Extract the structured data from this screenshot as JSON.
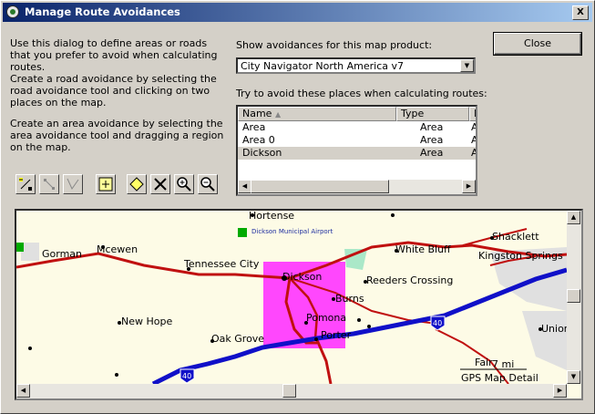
{
  "window": {
    "title": "Manage Route Avoidances",
    "close_glyph": "X"
  },
  "help": {
    "p1": "Use this dialog to define areas or roads that you prefer to avoid when calculating routes.",
    "p2": "Create a road avoidance by selecting the road avoidance tool and clicking on two places on the map.",
    "p3": "Create an area avoidance by selecting the area avoidance tool and dragging a region on the map."
  },
  "close_button": "Close",
  "product": {
    "label": "Show avoidances for this map product:",
    "value": "City Navigator North America v7"
  },
  "avoid_label": "Try to avoid these places when calculating routes:",
  "list": {
    "columns": [
      "Name",
      "Type",
      "P"
    ],
    "rows": [
      {
        "name": "Area",
        "type": "Area",
        "p": "A"
      },
      {
        "name": "Area 0",
        "type": "Area",
        "p": "A"
      },
      {
        "name": "Dickson",
        "type": "Area",
        "p": "A"
      }
    ]
  },
  "tools": [
    "road-avoid-add-icon",
    "road-avoid-select-icon",
    "road-avoid-draw-icon",
    "area-avoid-icon",
    "diamond-icon",
    "delete-icon",
    "zoom-in-icon",
    "zoom-out-icon"
  ],
  "map": {
    "labels": {
      "hortense": "Hortense",
      "airport": "Dickson Municipal Airport",
      "gorman": "Gorman",
      "mcewen": "Mcewen",
      "tennessee_city": "Tennessee City",
      "dickson": "Dickson",
      "white_bluff": "White Bluff",
      "shacklett": "Shacklett",
      "kingston_springs": "Kingston Springs",
      "reeders_crossing": "Reeders Crossing",
      "burns": "Burns",
      "new_hope": "New Hope",
      "pomona": "Pomona",
      "oak_grove": "Oak Grove",
      "porter": "Porter",
      "fair": "Fair",
      "union": "Union",
      "i40a": "40",
      "i40b": "40",
      "scale": "7 mi",
      "detail": "GPS Map Detail"
    },
    "colors": {
      "avoid_area": "#ff33ff",
      "interstate": "#1010c8",
      "highway": "#c01010",
      "background": "#fdfbe6"
    }
  }
}
